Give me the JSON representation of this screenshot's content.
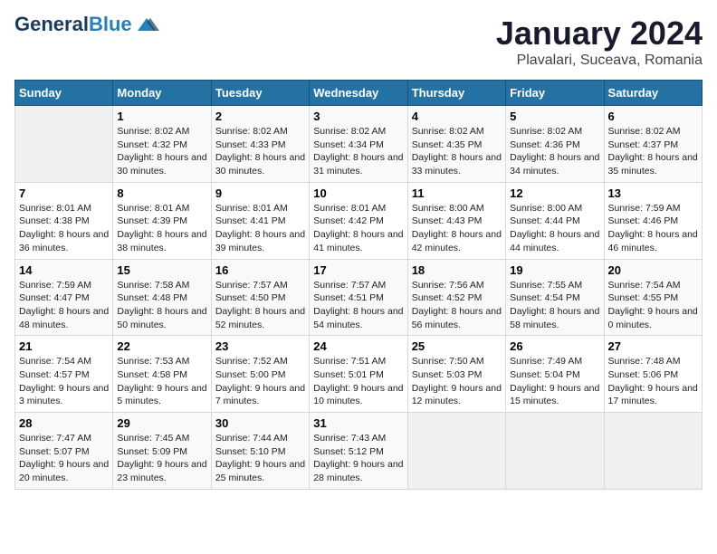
{
  "header": {
    "logo_line1": "General",
    "logo_line2": "Blue",
    "title": "January 2024",
    "subtitle": "Plavalari, Suceava, Romania"
  },
  "weekdays": [
    "Sunday",
    "Monday",
    "Tuesday",
    "Wednesday",
    "Thursday",
    "Friday",
    "Saturday"
  ],
  "weeks": [
    [
      {
        "day": "",
        "sunrise": "",
        "sunset": "",
        "daylight": ""
      },
      {
        "day": "1",
        "sunrise": "Sunrise: 8:02 AM",
        "sunset": "Sunset: 4:32 PM",
        "daylight": "Daylight: 8 hours and 30 minutes."
      },
      {
        "day": "2",
        "sunrise": "Sunrise: 8:02 AM",
        "sunset": "Sunset: 4:33 PM",
        "daylight": "Daylight: 8 hours and 30 minutes."
      },
      {
        "day": "3",
        "sunrise": "Sunrise: 8:02 AM",
        "sunset": "Sunset: 4:34 PM",
        "daylight": "Daylight: 8 hours and 31 minutes."
      },
      {
        "day": "4",
        "sunrise": "Sunrise: 8:02 AM",
        "sunset": "Sunset: 4:35 PM",
        "daylight": "Daylight: 8 hours and 33 minutes."
      },
      {
        "day": "5",
        "sunrise": "Sunrise: 8:02 AM",
        "sunset": "Sunset: 4:36 PM",
        "daylight": "Daylight: 8 hours and 34 minutes."
      },
      {
        "day": "6",
        "sunrise": "Sunrise: 8:02 AM",
        "sunset": "Sunset: 4:37 PM",
        "daylight": "Daylight: 8 hours and 35 minutes."
      }
    ],
    [
      {
        "day": "7",
        "sunrise": "Sunrise: 8:01 AM",
        "sunset": "Sunset: 4:38 PM",
        "daylight": "Daylight: 8 hours and 36 minutes."
      },
      {
        "day": "8",
        "sunrise": "Sunrise: 8:01 AM",
        "sunset": "Sunset: 4:39 PM",
        "daylight": "Daylight: 8 hours and 38 minutes."
      },
      {
        "day": "9",
        "sunrise": "Sunrise: 8:01 AM",
        "sunset": "Sunset: 4:41 PM",
        "daylight": "Daylight: 8 hours and 39 minutes."
      },
      {
        "day": "10",
        "sunrise": "Sunrise: 8:01 AM",
        "sunset": "Sunset: 4:42 PM",
        "daylight": "Daylight: 8 hours and 41 minutes."
      },
      {
        "day": "11",
        "sunrise": "Sunrise: 8:00 AM",
        "sunset": "Sunset: 4:43 PM",
        "daylight": "Daylight: 8 hours and 42 minutes."
      },
      {
        "day": "12",
        "sunrise": "Sunrise: 8:00 AM",
        "sunset": "Sunset: 4:44 PM",
        "daylight": "Daylight: 8 hours and 44 minutes."
      },
      {
        "day": "13",
        "sunrise": "Sunrise: 7:59 AM",
        "sunset": "Sunset: 4:46 PM",
        "daylight": "Daylight: 8 hours and 46 minutes."
      }
    ],
    [
      {
        "day": "14",
        "sunrise": "Sunrise: 7:59 AM",
        "sunset": "Sunset: 4:47 PM",
        "daylight": "Daylight: 8 hours and 48 minutes."
      },
      {
        "day": "15",
        "sunrise": "Sunrise: 7:58 AM",
        "sunset": "Sunset: 4:48 PM",
        "daylight": "Daylight: 8 hours and 50 minutes."
      },
      {
        "day": "16",
        "sunrise": "Sunrise: 7:57 AM",
        "sunset": "Sunset: 4:50 PM",
        "daylight": "Daylight: 8 hours and 52 minutes."
      },
      {
        "day": "17",
        "sunrise": "Sunrise: 7:57 AM",
        "sunset": "Sunset: 4:51 PM",
        "daylight": "Daylight: 8 hours and 54 minutes."
      },
      {
        "day": "18",
        "sunrise": "Sunrise: 7:56 AM",
        "sunset": "Sunset: 4:52 PM",
        "daylight": "Daylight: 8 hours and 56 minutes."
      },
      {
        "day": "19",
        "sunrise": "Sunrise: 7:55 AM",
        "sunset": "Sunset: 4:54 PM",
        "daylight": "Daylight: 8 hours and 58 minutes."
      },
      {
        "day": "20",
        "sunrise": "Sunrise: 7:54 AM",
        "sunset": "Sunset: 4:55 PM",
        "daylight": "Daylight: 9 hours and 0 minutes."
      }
    ],
    [
      {
        "day": "21",
        "sunrise": "Sunrise: 7:54 AM",
        "sunset": "Sunset: 4:57 PM",
        "daylight": "Daylight: 9 hours and 3 minutes."
      },
      {
        "day": "22",
        "sunrise": "Sunrise: 7:53 AM",
        "sunset": "Sunset: 4:58 PM",
        "daylight": "Daylight: 9 hours and 5 minutes."
      },
      {
        "day": "23",
        "sunrise": "Sunrise: 7:52 AM",
        "sunset": "Sunset: 5:00 PM",
        "daylight": "Daylight: 9 hours and 7 minutes."
      },
      {
        "day": "24",
        "sunrise": "Sunrise: 7:51 AM",
        "sunset": "Sunset: 5:01 PM",
        "daylight": "Daylight: 9 hours and 10 minutes."
      },
      {
        "day": "25",
        "sunrise": "Sunrise: 7:50 AM",
        "sunset": "Sunset: 5:03 PM",
        "daylight": "Daylight: 9 hours and 12 minutes."
      },
      {
        "day": "26",
        "sunrise": "Sunrise: 7:49 AM",
        "sunset": "Sunset: 5:04 PM",
        "daylight": "Daylight: 9 hours and 15 minutes."
      },
      {
        "day": "27",
        "sunrise": "Sunrise: 7:48 AM",
        "sunset": "Sunset: 5:06 PM",
        "daylight": "Daylight: 9 hours and 17 minutes."
      }
    ],
    [
      {
        "day": "28",
        "sunrise": "Sunrise: 7:47 AM",
        "sunset": "Sunset: 5:07 PM",
        "daylight": "Daylight: 9 hours and 20 minutes."
      },
      {
        "day": "29",
        "sunrise": "Sunrise: 7:45 AM",
        "sunset": "Sunset: 5:09 PM",
        "daylight": "Daylight: 9 hours and 23 minutes."
      },
      {
        "day": "30",
        "sunrise": "Sunrise: 7:44 AM",
        "sunset": "Sunset: 5:10 PM",
        "daylight": "Daylight: 9 hours and 25 minutes."
      },
      {
        "day": "31",
        "sunrise": "Sunrise: 7:43 AM",
        "sunset": "Sunset: 5:12 PM",
        "daylight": "Daylight: 9 hours and 28 minutes."
      },
      {
        "day": "",
        "sunrise": "",
        "sunset": "",
        "daylight": ""
      },
      {
        "day": "",
        "sunrise": "",
        "sunset": "",
        "daylight": ""
      },
      {
        "day": "",
        "sunrise": "",
        "sunset": "",
        "daylight": ""
      }
    ]
  ]
}
